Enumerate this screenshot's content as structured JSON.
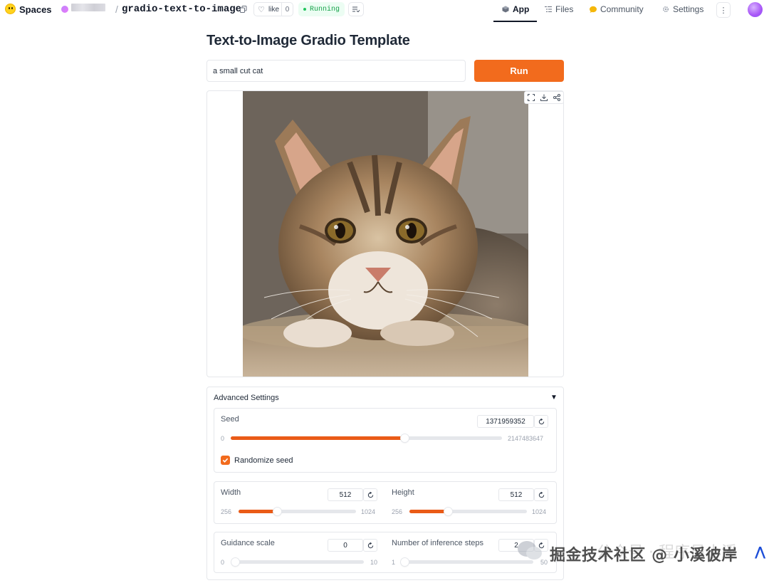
{
  "nav": {
    "brand": "Spaces",
    "repo_name": "gradio-text-to-image",
    "like_label": "like",
    "like_count": "0",
    "status": "Running",
    "tabs": [
      {
        "label": "App"
      },
      {
        "label": "Files"
      },
      {
        "label": "Community"
      },
      {
        "label": "Settings"
      }
    ]
  },
  "app": {
    "title": "Text-to-Image Gradio Template",
    "prompt_value": "a small cut cat",
    "run_label": "Run"
  },
  "advanced": {
    "title": "Advanced Settings",
    "toggle": "▼",
    "seed": {
      "label": "Seed",
      "value": "1371959352",
      "min": "0",
      "max": "2147483647",
      "fraction": 0.64
    },
    "randomize_label": "Randomize seed",
    "randomize_checked": true,
    "width": {
      "label": "Width",
      "value": "512",
      "min": "256",
      "max": "1024",
      "fraction": 0.33
    },
    "height": {
      "label": "Height",
      "value": "512",
      "min": "256",
      "max": "1024",
      "fraction": 0.33
    },
    "guidance": {
      "label": "Guidance scale",
      "value": "0",
      "min": "0",
      "max": "10",
      "fraction": 0.0
    },
    "steps": {
      "label": "Number of inference steps",
      "value": "2",
      "min": "1",
      "max": "50",
      "fraction": 0.02
    }
  },
  "watermark": {
    "text": "掘金技术社区 @ 小溪彼岸",
    "faint_text": "公众号 · 程序员小溪"
  },
  "colors": {
    "accent": "#f26b1d",
    "slider_fill": "#ea5b17",
    "running_green": "#16a34a"
  }
}
